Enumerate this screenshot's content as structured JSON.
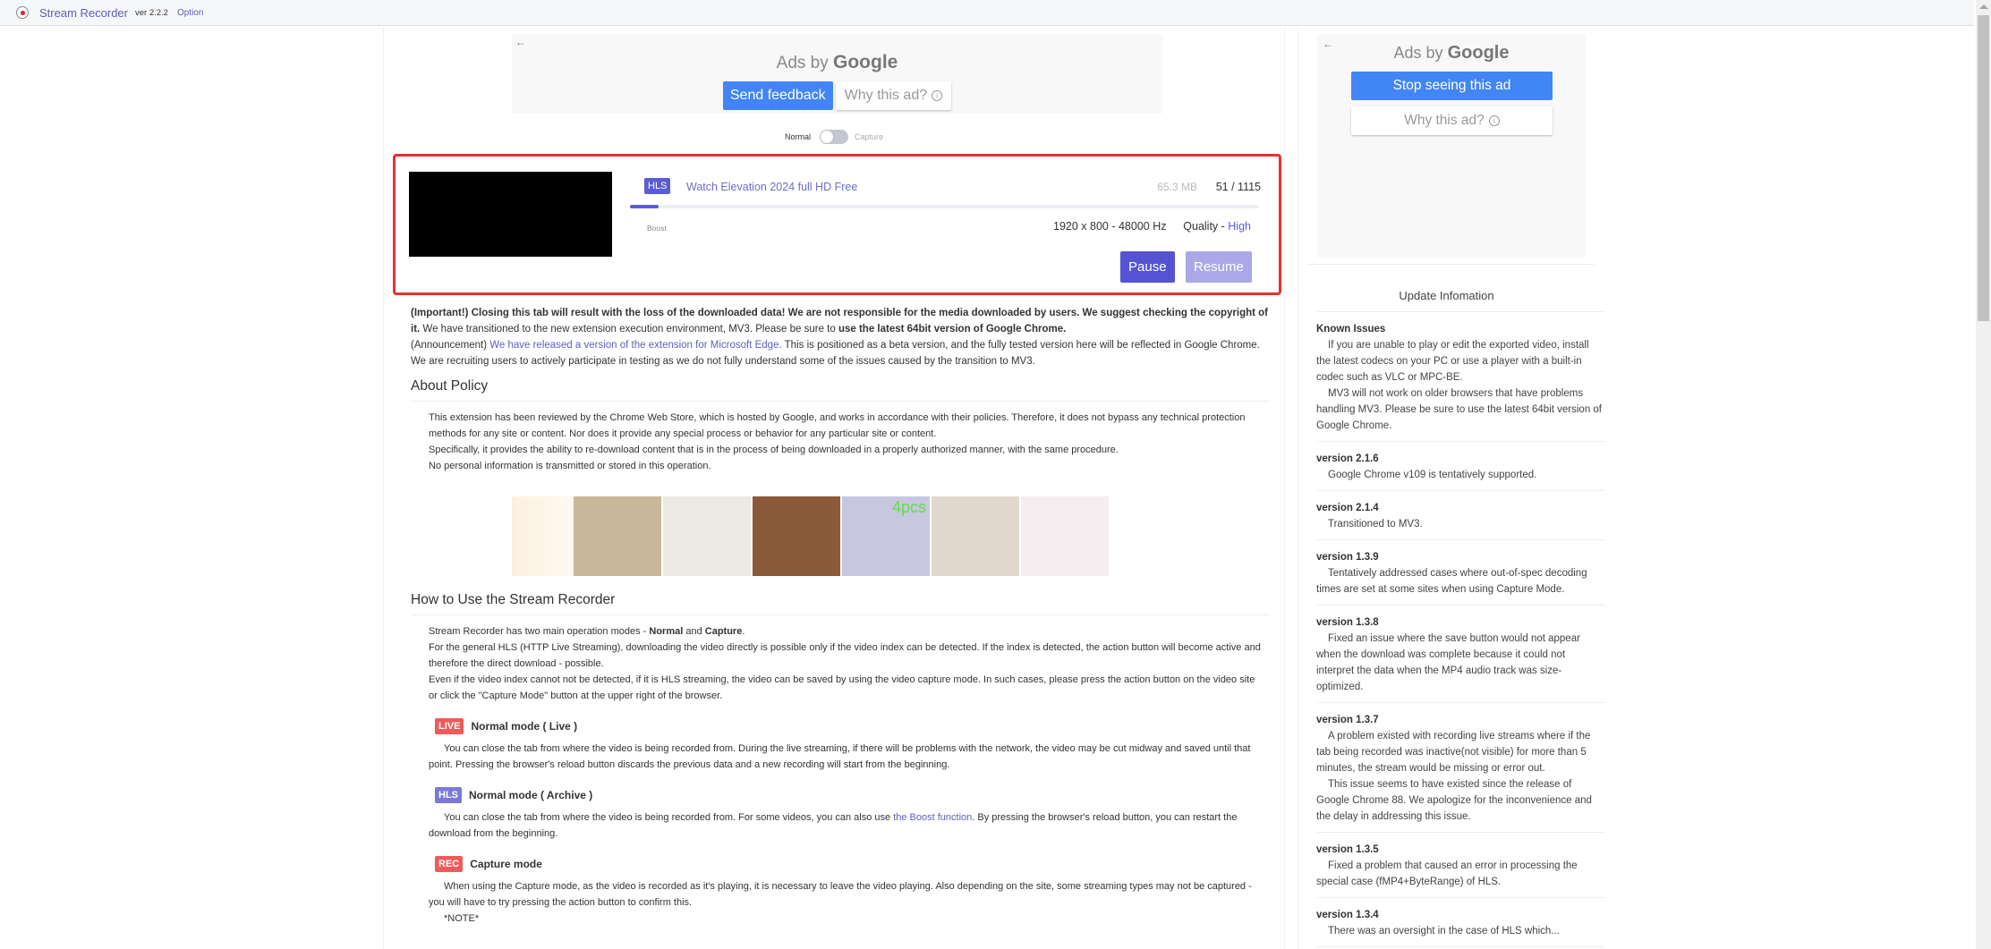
{
  "topbar": {
    "icon": "record-icon",
    "title": "Stream Recorder",
    "version": "ver 2.2.2",
    "option_label": "Option"
  },
  "ad_top": {
    "back": "←",
    "ads_by": "Ads by",
    "google": "Google",
    "send_feedback": "Send feedback",
    "why_this_ad": "Why this ad?",
    "info_glyph": "i"
  },
  "mode_toggle": {
    "normal_label": "Normal",
    "capture_label": "Capture",
    "selected": "Normal"
  },
  "download": {
    "badge": "HLS",
    "title": "Watch Elevation 2024 full HD Free",
    "size": "65.3 MB",
    "count": "51 / 1115",
    "progress_percent": 4.6,
    "boost_label": "Boost",
    "resolution": "1920 x 800 - 48000 Hz",
    "quality_label": "Quality - ",
    "quality_value": "High",
    "pause_label": "Pause",
    "resume_label": "Resume"
  },
  "notice": {
    "important": "(Important!) Closing this tab will result with the loss of the downloaded data! We are not responsible for the media downloaded by users. We suggest checking the copyright of it.",
    "mv3_text": " We have transitioned to the new extension execution environment, MV3. Please be sure to ",
    "mv3_bold": "use the latest 64bit version of Google Chrome.",
    "announce_prefix": "(Announcement) ",
    "announce_link": "We have released a version of the extension for Microsoft Edge.",
    "announce_text": " This is positioned as a beta version, and the fully tested version here will be reflected in Google Chrome. We are recruiting users to actively participate in testing as we do not fully understand some of the issues caused by the transition to MV3."
  },
  "policy": {
    "heading": "About Policy",
    "lines": [
      "This extension has been reviewed by the Chrome Web Store, which is hosted by Google, and works in accordance with their policies. Therefore, it does not bypass any technical protection methods for any site or content. Nor does it provide any special process or behavior for any particular site or content.",
      "Specifically, it provides the ability to re-download content that is in the process of being downloaded in a properly authorized manner, with the same procedure.",
      "No personal information is transmitted or stored in this operation."
    ]
  },
  "ad_strip": {
    "items": [
      {
        "name": "sweater-ad",
        "color": "#c9b79a"
      },
      {
        "name": "shapewear-ad",
        "color": "#ece8e4"
      },
      {
        "name": "fishing-bait-ad",
        "color": "#8a5a3a"
      },
      {
        "name": "shower-cap-ad",
        "color": "#c7c8e0",
        "caption": "4pcs"
      },
      {
        "name": "sneakers-ad",
        "color": "#e3d8cd"
      },
      {
        "name": "earplugs-ad",
        "color": "#f4eef0"
      }
    ]
  },
  "howto": {
    "heading": "How to Use the Stream Recorder",
    "intro_prefix": "Stream Recorder has two main operation modes - ",
    "intro_normal": "Normal",
    "intro_and": " and ",
    "intro_capture": "Capture",
    "intro_end": ".",
    "line2": "For the general HLS (HTTP Live Streaming), downloading the video directly is possible only if the video index can be detected. If the index is detected, the action button will become active and therefore the direct download - possible.",
    "line3": "Even if the video index cannot not be detected, if it is HLS streaming, the video can be saved by using the video capture mode. In such cases, please press the action button on the video site or click the \"Capture Mode\" button at the upper right of the browser.",
    "modes": [
      {
        "badge": "LIVE",
        "title": "Normal mode ( Live )",
        "desc": "You can close the tab from where the video is being recorded from. During the live streaming, if there will be problems with the network, the video may be cut midway and saved until that point. Pressing the browser's reload button discards the previous data and a new recording will start from the beginning."
      },
      {
        "badge": "HLS",
        "title": "Normal mode ( Archive )",
        "desc_prefix": "You can close the tab from where the video is being recorded from. For some videos, you can also use ",
        "desc_link": "the Boost function",
        "desc_suffix": ". By pressing the browser's reload button, you can restart the download from the beginning."
      },
      {
        "badge": "REC",
        "title": "Capture mode",
        "desc": "When using the Capture mode, as the video is recorded as it's playing, it is necessary to leave the video playing. Also depending on the site, some streaming types may not be captured - you will have to try pressing the action button to confirm this.",
        "note": "*NOTE*"
      }
    ]
  },
  "ad_side": {
    "back": "←",
    "ads_by": "Ads by",
    "google": "Google",
    "stop_seeing": "Stop seeing this ad",
    "why_this_ad": "Why this ad?",
    "info_glyph": "i"
  },
  "updates": {
    "title": "Update Infomation",
    "items": [
      {
        "ver": "Known Issues",
        "desc": [
          "If you are unable to play or edit the exported video, install the latest codecs on your PC or use a player with a built-in codec such as VLC or MPC-BE.",
          "MV3 will not work on older browsers that have problems handling MV3. Please be sure to use the latest 64bit version of Google Chrome."
        ]
      },
      {
        "ver": "version 2.1.6",
        "desc": [
          "Google Chrome v109 is tentatively supported."
        ]
      },
      {
        "ver": "version 2.1.4",
        "desc": [
          "Transitioned to MV3."
        ]
      },
      {
        "ver": "version 1.3.9",
        "desc": [
          "Tentatively addressed cases where out-of-spec decoding times are set at some sites when using Capture Mode."
        ]
      },
      {
        "ver": "version 1.3.8",
        "desc": [
          "Fixed an issue where the save button would not appear when the download was complete because it could not interpret the data when the MP4 audio track was size-optimized."
        ]
      },
      {
        "ver": "version 1.3.7",
        "desc": [
          "A problem existed with recording live streams where if the tab being recorded was inactive(not visible) for more than 5 minutes, the stream would be missing or error out.",
          "This issue seems to have existed since the release of Google Chrome 88. We apologize for the inconvenience and the delay in addressing this issue."
        ]
      },
      {
        "ver": "version 1.3.5",
        "desc": [
          "Fixed a problem that caused an error in processing the special case (fMP4+ByteRange) of HLS."
        ]
      },
      {
        "ver": "version 1.3.4",
        "desc": [
          "There was an oversight in the case of HLS which..."
        ]
      }
    ]
  },
  "colors": {
    "accent": "#5b5dd6",
    "highlight_border": "#e7312f",
    "google_blue": "#4285f4",
    "live_badge": "#f05a5a"
  }
}
